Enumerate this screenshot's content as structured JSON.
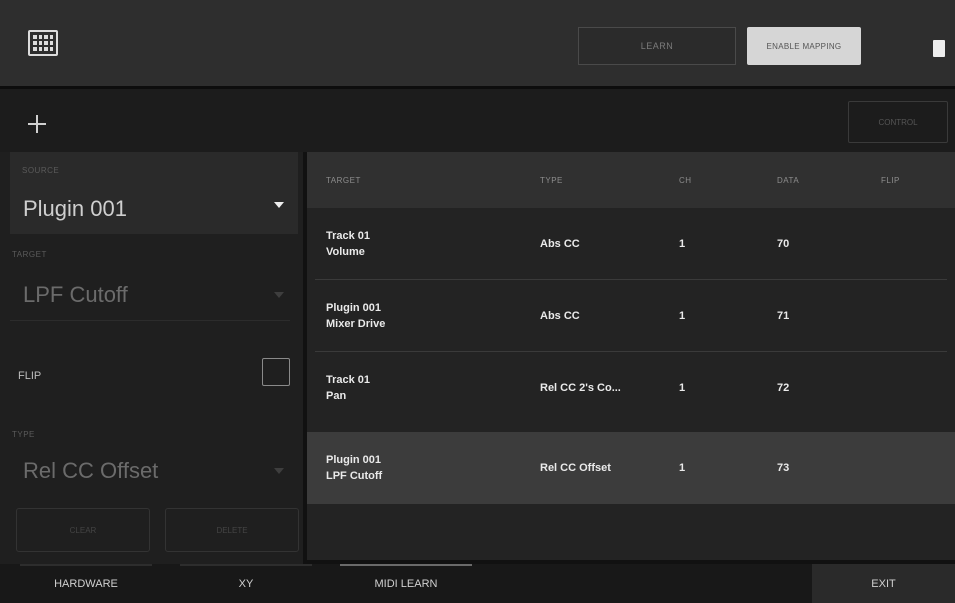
{
  "header": {
    "learn_label": "LEARN",
    "enable_mapping_label": "ENABLE MAPPING"
  },
  "toolbar": {
    "control_label": "CONTROL"
  },
  "left_panel": {
    "source_label": "SOURCE",
    "source_value": "Plugin 001",
    "target_label": "TARGET",
    "target_value": "LPF Cutoff",
    "flip_label": "FLIP",
    "flip_checked": false,
    "type_label": "TYPE",
    "type_value": "Rel CC Offset",
    "button_left_label": "CLEAR",
    "button_right_label": "DELETE"
  },
  "table": {
    "columns": [
      "TARGET",
      "TYPE",
      "CH",
      "DATA",
      "FLIP"
    ],
    "rows": [
      {
        "target_line1": "Track 01",
        "target_line2": "Volume",
        "type": "Abs CC",
        "ch": "1",
        "data": "70",
        "flip": ""
      },
      {
        "target_line1": "Plugin 001",
        "target_line2": "Mixer Drive",
        "type": "Abs CC",
        "ch": "1",
        "data": "71",
        "flip": ""
      },
      {
        "target_line1": "Track 01",
        "target_line2": "Pan",
        "type": "Rel CC 2's Co...",
        "ch": "1",
        "data": "72",
        "flip": ""
      },
      {
        "target_line1": "Plugin 001",
        "target_line2": "LPF Cutoff",
        "type": "Rel CC Offset",
        "ch": "1",
        "data": "73",
        "flip": ""
      }
    ],
    "selected_row": 3
  },
  "bottom_bar": {
    "hardware_label": "HARDWARE",
    "xy_label": "XY",
    "midi_learn_label": "MIDI LEARN",
    "exit_label": "EXIT"
  },
  "icons": {
    "menu": "grid-menu-icon",
    "add": "plus-icon",
    "clip": "clip-icon",
    "dropdown": "dropdown-arrow-icon"
  }
}
